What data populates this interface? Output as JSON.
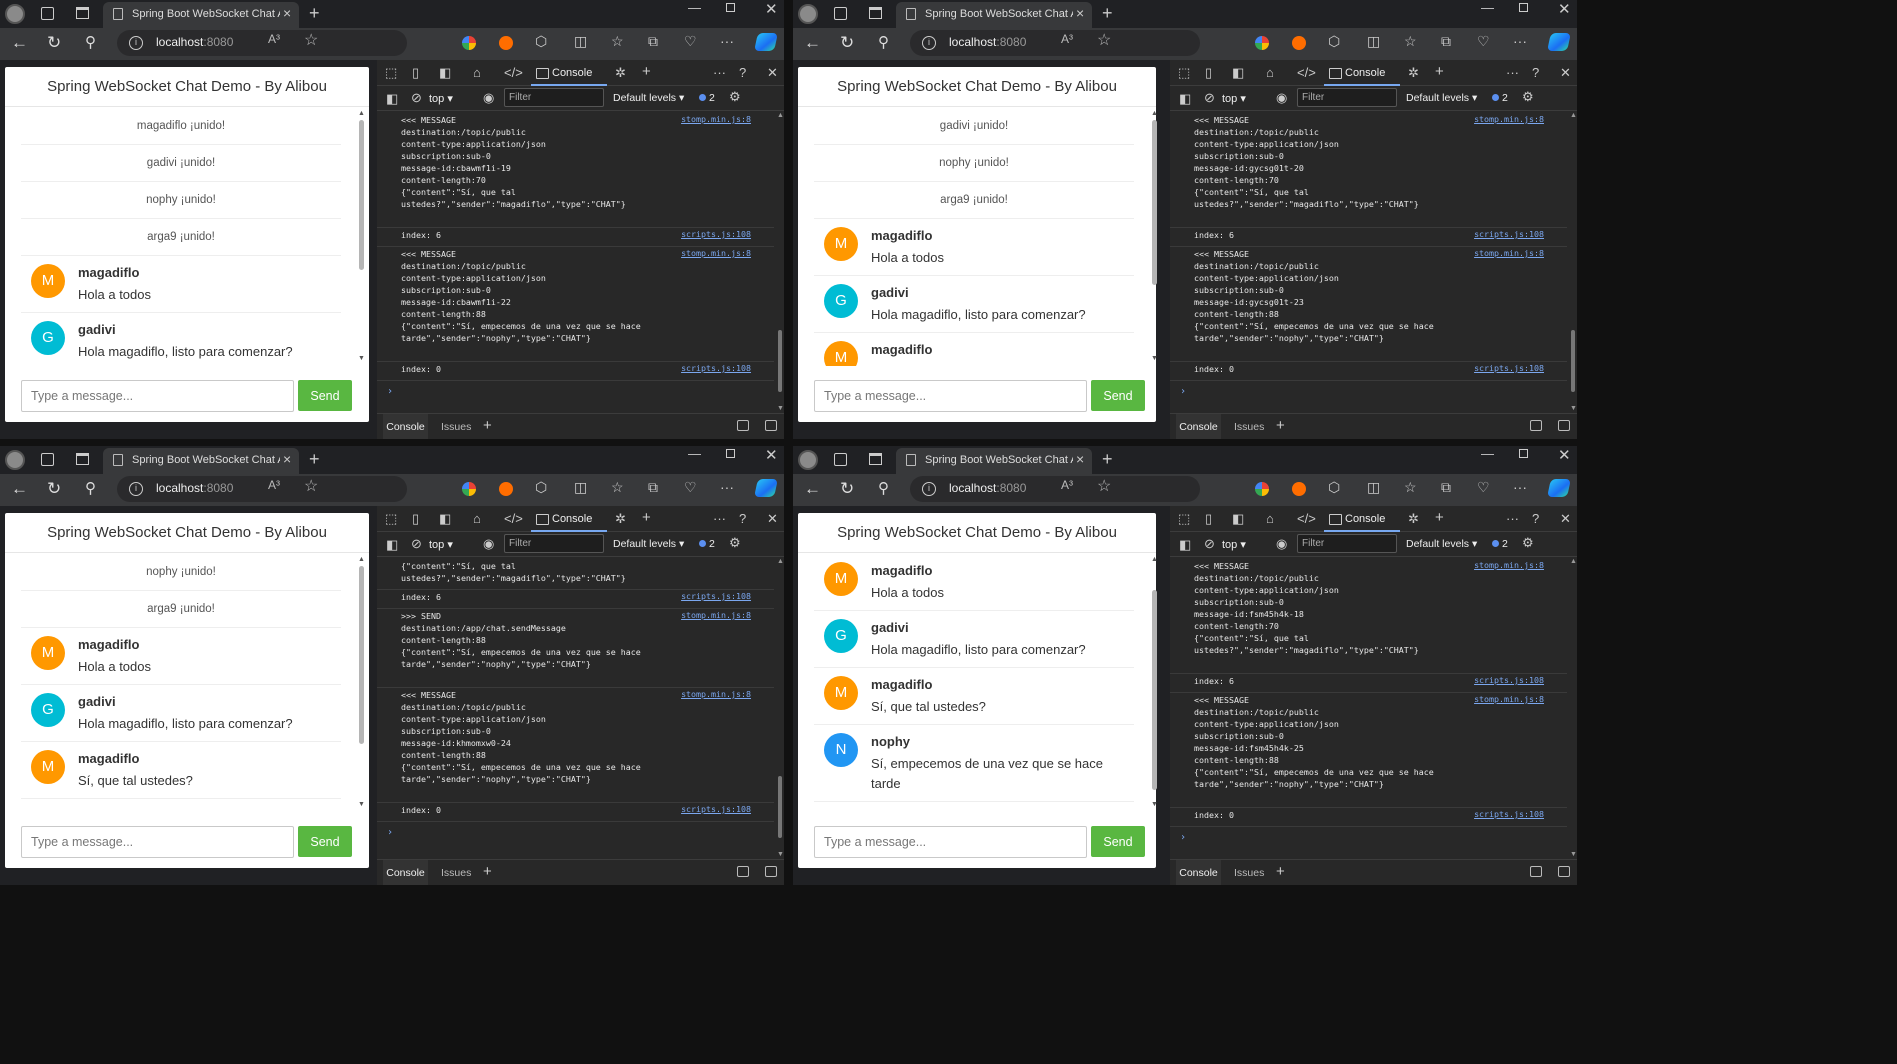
{
  "browser": {
    "tab_title": "Spring Boot WebSocket Chat App",
    "url_host": "localhost",
    "url_port": ":8080",
    "read_aloud": "A³"
  },
  "app": {
    "title": "Spring WebSocket Chat Demo - By Alibou",
    "input_placeholder": "Type a message...",
    "send_label": "Send"
  },
  "colors": {
    "orange": "#ff9800",
    "teal": "#00bcd4",
    "blue": "#2196f3",
    "send": "#59b741"
  },
  "devtools": {
    "console_tab": "Console",
    "top": "top",
    "filter": "Filter",
    "levels": "Default levels",
    "issues_count": "2",
    "bottom_console": "Console",
    "bottom_issues": "Issues",
    "src_stomp": "stomp.min.js:8",
    "src_scripts": "scripts.js:108"
  },
  "windows": [
    {
      "chat": [
        {
          "kind": "event",
          "text": "magadiflo ¡unido!"
        },
        {
          "kind": "event",
          "text": "gadivi ¡unido!"
        },
        {
          "kind": "event",
          "text": "nophy ¡unido!"
        },
        {
          "kind": "event",
          "text": "arga9 ¡unido!"
        },
        {
          "kind": "msg",
          "initial": "M",
          "color": "orange",
          "sender": "magadiflo",
          "text": "Hola a todos"
        },
        {
          "kind": "msg",
          "initial": "G",
          "color": "teal",
          "sender": "gadivi",
          "text": "Hola magadiflo, listo para comenzar?"
        }
      ],
      "log": [
        {
          "src": "stomp",
          "lines": [
            "<<< MESSAGE",
            "destination:/topic/public",
            "content-type:application/json",
            "subscription:sub-0",
            "message-id:cbawmf1i-19",
            "content-length:70",
            "",
            "{\"content\":\"Sí, que tal",
            "ustedes?\",\"sender\":\"magadiflo\",\"type\":\"CHAT\"}"
          ]
        },
        {
          "src": "scripts",
          "lines": [
            "index: 6"
          ]
        },
        {
          "src": "stomp",
          "lines": [
            "<<< MESSAGE",
            "destination:/topic/public",
            "content-type:application/json",
            "subscription:sub-0",
            "message-id:cbawmf1i-22",
            "content-length:88",
            "",
            "{\"content\":\"Sí, empecemos de una vez que se hace",
            "tarde\",\"sender\":\"nophy\",\"type\":\"CHAT\"}"
          ]
        },
        {
          "src": "scripts",
          "lines": [
            "index: 0"
          ]
        }
      ]
    },
    {
      "chat": [
        {
          "kind": "event",
          "text": "gadivi ¡unido!"
        },
        {
          "kind": "event",
          "text": "nophy ¡unido!"
        },
        {
          "kind": "event",
          "text": "arga9 ¡unido!"
        },
        {
          "kind": "msg",
          "initial": "M",
          "color": "orange",
          "sender": "magadiflo",
          "text": "Hola a todos"
        },
        {
          "kind": "msg",
          "initial": "G",
          "color": "teal",
          "sender": "gadivi",
          "text": "Hola magadiflo, listo para comenzar?"
        },
        {
          "kind": "msg",
          "initial": "M",
          "color": "orange",
          "sender": "magadiflo",
          "text": ""
        }
      ],
      "log": [
        {
          "src": "stomp",
          "lines": [
            "<<< MESSAGE",
            "destination:/topic/public",
            "content-type:application/json",
            "subscription:sub-0",
            "message-id:gycsg01t-20",
            "content-length:70",
            "",
            "{\"content\":\"Sí, que tal",
            "ustedes?\",\"sender\":\"magadiflo\",\"type\":\"CHAT\"}"
          ]
        },
        {
          "src": "scripts",
          "lines": [
            "index: 6"
          ]
        },
        {
          "src": "stomp",
          "lines": [
            "<<< MESSAGE",
            "destination:/topic/public",
            "content-type:application/json",
            "subscription:sub-0",
            "message-id:gycsg01t-23",
            "content-length:88",
            "",
            "{\"content\":\"Sí, empecemos de una vez que se hace",
            "tarde\",\"sender\":\"nophy\",\"type\":\"CHAT\"}"
          ]
        },
        {
          "src": "scripts",
          "lines": [
            "index: 0"
          ]
        }
      ]
    },
    {
      "chat": [
        {
          "kind": "event",
          "text": "nophy ¡unido!"
        },
        {
          "kind": "event",
          "text": "arga9 ¡unido!"
        },
        {
          "kind": "msg",
          "initial": "M",
          "color": "orange",
          "sender": "magadiflo",
          "text": "Hola a todos"
        },
        {
          "kind": "msg",
          "initial": "G",
          "color": "teal",
          "sender": "gadivi",
          "text": "Hola magadiflo, listo para comenzar?"
        },
        {
          "kind": "msg",
          "initial": "M",
          "color": "orange",
          "sender": "magadiflo",
          "text": "Sí, que tal ustedes?"
        }
      ],
      "log": [
        {
          "src": "",
          "lines": [
            "{\"content\":\"Sí, que tal",
            "ustedes?\",\"sender\":\"magadiflo\",\"type\":\"CHAT\"}"
          ]
        },
        {
          "src": "scripts",
          "lines": [
            "index: 6"
          ]
        },
        {
          "src": "stomp",
          "lines": [
            ">>> SEND",
            "destination:/app/chat.sendMessage",
            "content-length:88",
            "",
            "{\"content\":\"Sí, empecemos de una vez que se hace",
            "tarde\",\"sender\":\"nophy\",\"type\":\"CHAT\"}"
          ]
        },
        {
          "src": "stomp",
          "lines": [
            "<<< MESSAGE",
            "destination:/topic/public",
            "content-type:application/json",
            "subscription:sub-0",
            "message-id:khmomxw0-24",
            "content-length:88",
            "",
            "{\"content\":\"Sí, empecemos de una vez que se hace",
            "tarde\",\"sender\":\"nophy\",\"type\":\"CHAT\"}"
          ]
        },
        {
          "src": "scripts",
          "lines": [
            "index: 0"
          ]
        }
      ]
    },
    {
      "chat": [
        {
          "kind": "msg",
          "initial": "M",
          "color": "orange",
          "sender": "magadiflo",
          "text": "Hola a todos"
        },
        {
          "kind": "msg",
          "initial": "G",
          "color": "teal",
          "sender": "gadivi",
          "text": "Hola magadiflo, listo para comenzar?"
        },
        {
          "kind": "msg",
          "initial": "M",
          "color": "orange",
          "sender": "magadiflo",
          "text": "Sí, que tal ustedes?"
        },
        {
          "kind": "msg",
          "initial": "N",
          "color": "blue",
          "sender": "nophy",
          "text": "Sí, empecemos de una vez que se hace tarde"
        }
      ],
      "log": [
        {
          "src": "stomp",
          "lines": [
            "<<< MESSAGE",
            "destination:/topic/public",
            "content-type:application/json",
            "subscription:sub-0",
            "message-id:fsm45h4k-18",
            "content-length:70",
            "",
            "{\"content\":\"Sí, que tal",
            "ustedes?\",\"sender\":\"magadiflo\",\"type\":\"CHAT\"}"
          ]
        },
        {
          "src": "scripts",
          "lines": [
            "index: 6"
          ]
        },
        {
          "src": "stomp",
          "lines": [
            "<<< MESSAGE",
            "destination:/topic/public",
            "content-type:application/json",
            "subscription:sub-0",
            "message-id:fsm45h4k-25",
            "content-length:88",
            "",
            "{\"content\":\"Sí, empecemos de una vez que se hace",
            "tarde\",\"sender\":\"nophy\",\"type\":\"CHAT\"}"
          ]
        },
        {
          "src": "scripts",
          "lines": [
            "index: 0"
          ]
        }
      ]
    }
  ]
}
